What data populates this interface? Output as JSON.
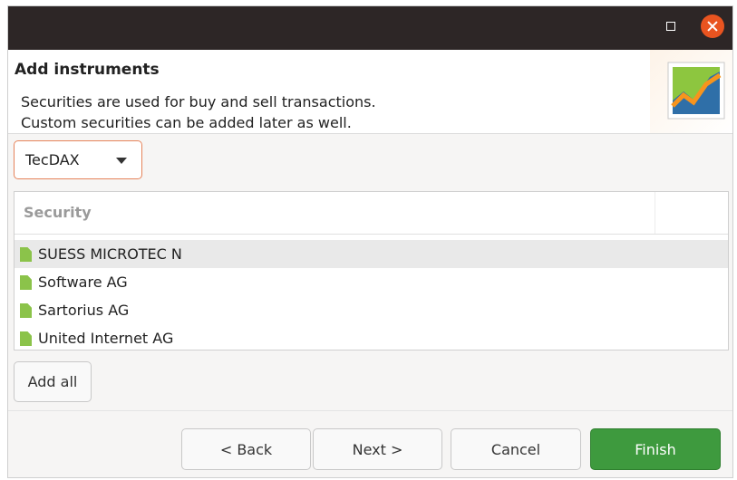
{
  "titlebar": {
    "maximize_icon": "maximize-icon",
    "close_icon": "close-icon",
    "close_color": "#e95420"
  },
  "header": {
    "title": "Add instruments",
    "description_line1": "Securities are used for buy and sell transactions.",
    "description_line2": "Custom securities can be added later as well.",
    "logo_icon": "chart-logo-icon"
  },
  "index_dropdown": {
    "selected": "TecDAX"
  },
  "securities_table": {
    "column_header": "Security",
    "rows": [
      {
        "label": "SUESS MICROTEC N",
        "selected": true
      },
      {
        "label": "Software AG",
        "selected": false
      },
      {
        "label": "Sartorius AG",
        "selected": false
      },
      {
        "label": "United Internet AG",
        "selected": false
      }
    ],
    "row_icon": "document-icon",
    "row_icon_color": "#8bc34a"
  },
  "buttons": {
    "add_all": "Add all",
    "back": "< Back",
    "next": "Next >",
    "cancel": "Cancel",
    "finish": "Finish",
    "finish_color": "#3e9a3e"
  }
}
